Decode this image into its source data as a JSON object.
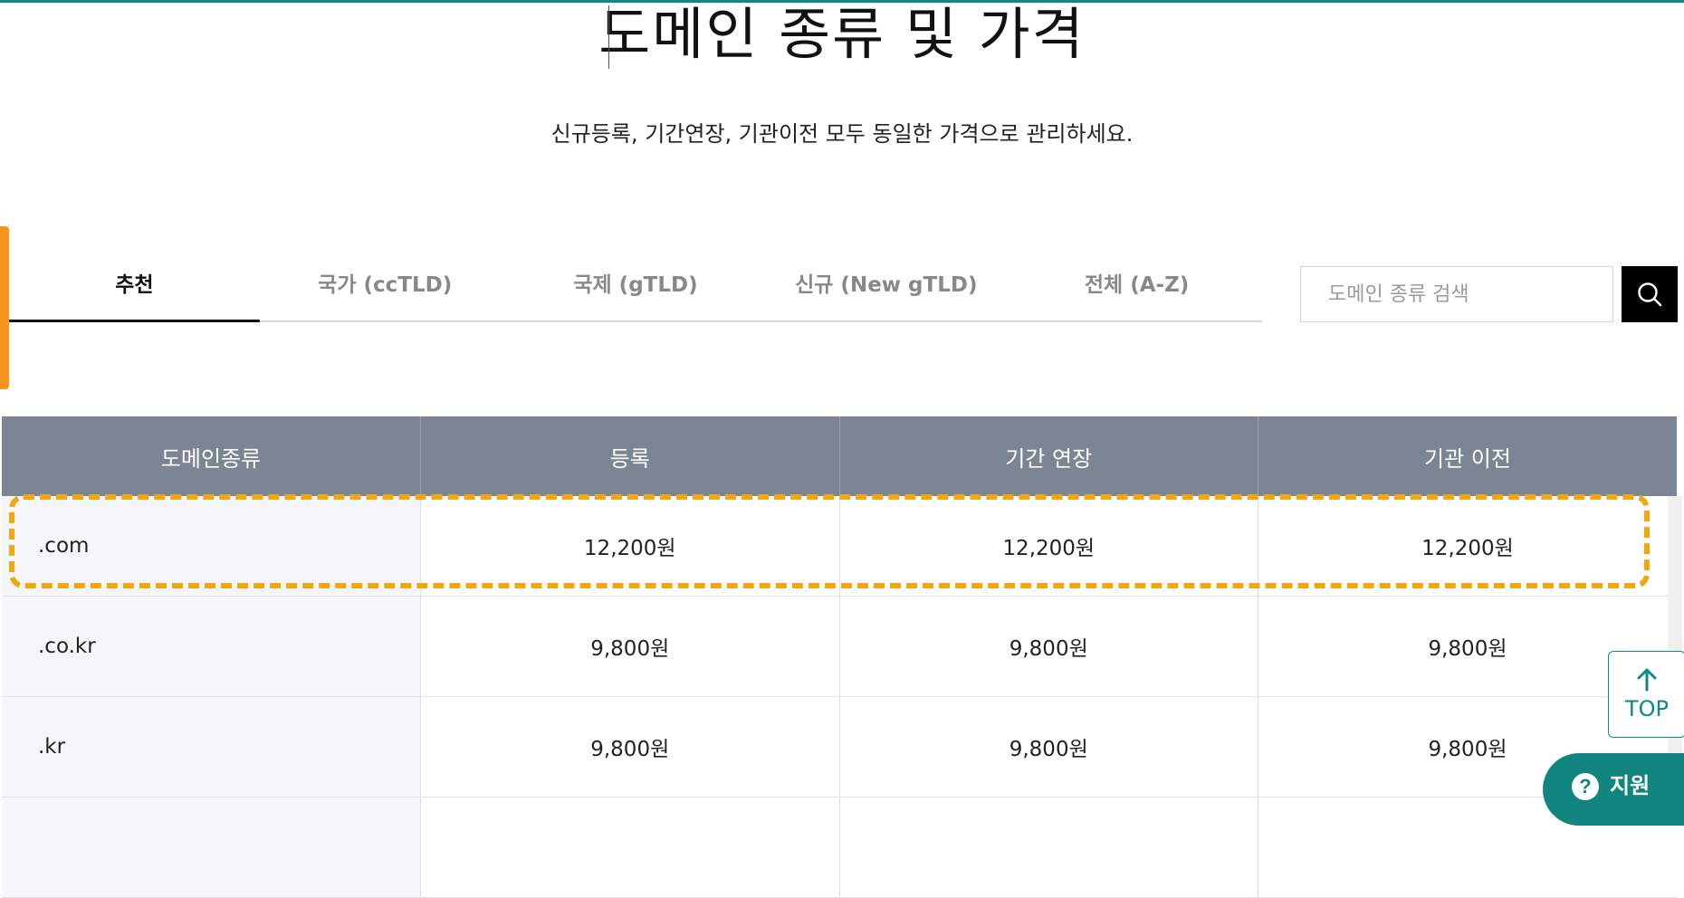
{
  "header": {
    "title": "도메인 종류 및 가격",
    "subtitle": "신규등록, 기간연장, 기관이전 모두 동일한 가격으로 관리하세요."
  },
  "tabs": [
    {
      "label": "추천",
      "active": true
    },
    {
      "label": "국가 (ccTLD)",
      "active": false
    },
    {
      "label": "국제 (gTLD)",
      "active": false
    },
    {
      "label": "신규 (New gTLD)",
      "active": false
    },
    {
      "label": "전체 (A-Z)",
      "active": false
    }
  ],
  "search": {
    "placeholder": "도메인 종류 검색",
    "value": "",
    "icon": "search-icon"
  },
  "table": {
    "columns": [
      "도메인종류",
      "등록",
      "기간 연장",
      "기관 이전"
    ],
    "rows": [
      {
        "name": ".com",
        "register": "12,200원",
        "renew": "12,200원",
        "transfer": "12,200원",
        "highlighted": true
      },
      {
        "name": ".co.kr",
        "register": "9,800원",
        "renew": "9,800원",
        "transfer": "9,800원"
      },
      {
        "name": ".kr",
        "register": "9,800원",
        "renew": "9,800원",
        "transfer": "9,800원"
      },
      {
        "name": "",
        "register": "",
        "renew": "",
        "transfer": ""
      }
    ]
  },
  "floating": {
    "top_label": "TOP",
    "support_label": "지원",
    "support_icon": "question-icon"
  },
  "colors": {
    "accent": "#0d8a86",
    "highlight": "#f2a60f",
    "header_bg": "#7c8594",
    "left_tab": "#f7941d"
  }
}
